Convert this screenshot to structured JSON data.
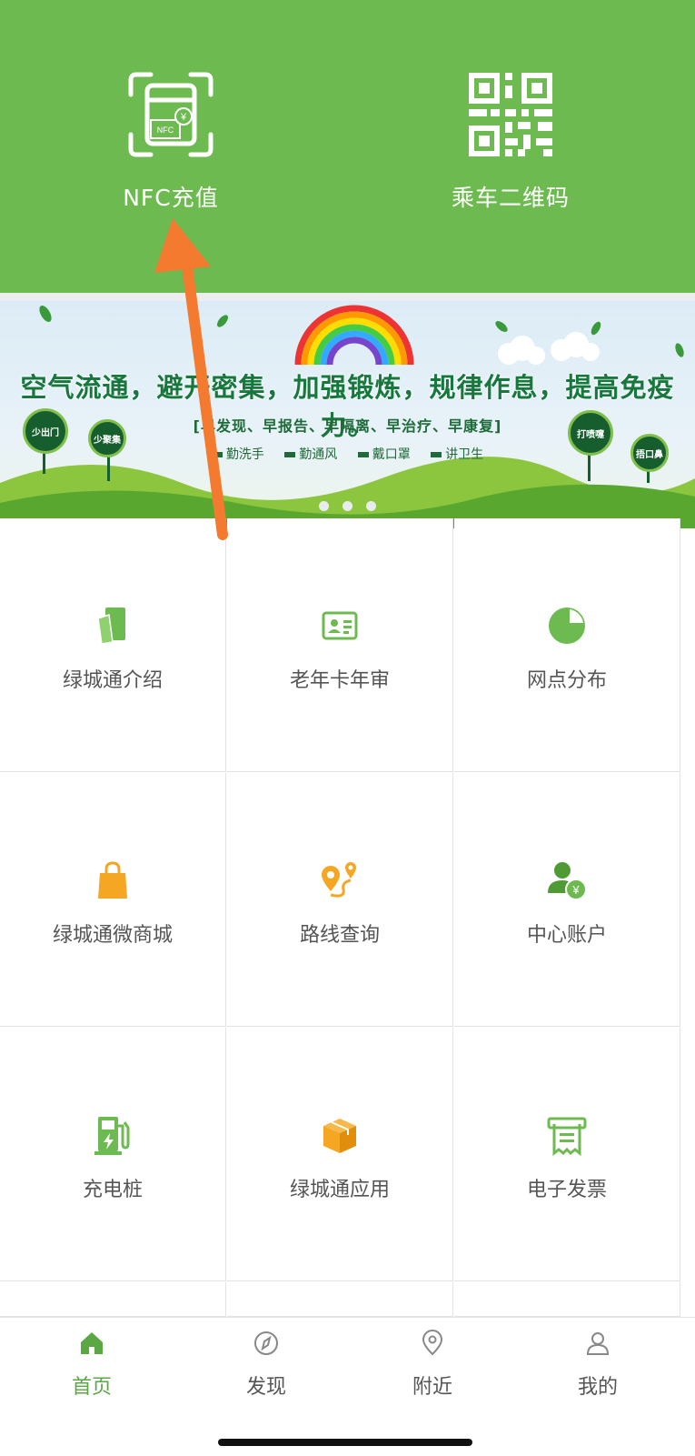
{
  "hero": {
    "nfc": {
      "label": "NFC充值",
      "icon": "nfc-card-icon",
      "icon_text": "NFC"
    },
    "qr": {
      "label": "乘车二维码",
      "icon": "qr-code-icon"
    }
  },
  "banner": {
    "slogan": "空气流通，避开密集，加强锻炼，规律作息，提高免疫力。",
    "subline": "[早发现、早报告、早隔离、早治疗、早康复]",
    "tips": [
      "勤洗手",
      "勤通风",
      "戴口罩",
      "讲卫生"
    ],
    "signs": [
      "少出门",
      "少聚集",
      "打喷嚏",
      "捂口鼻"
    ],
    "page_dots": 3
  },
  "grid": [
    {
      "label": "绿城通介绍",
      "icon": "card-icon",
      "color": "#6dbb50"
    },
    {
      "label": "老年卡年审",
      "icon": "id-card-icon",
      "color": "#6dbb50"
    },
    {
      "label": "网点分布",
      "icon": "pie-chart-icon",
      "color": "#6dbb50"
    },
    {
      "label": "绿城通微商城",
      "icon": "shopping-bag-icon",
      "color": "#f5a623"
    },
    {
      "label": "路线查询",
      "icon": "route-icon",
      "color": "#f5a623"
    },
    {
      "label": "中心账户",
      "icon": "account-yen-icon",
      "color": "#6dbb50"
    },
    {
      "label": "充电桩",
      "icon": "charging-station-icon",
      "color": "#6dbb50"
    },
    {
      "label": "绿城通应用",
      "icon": "box-icon",
      "color": "#f5a623"
    },
    {
      "label": "电子发票",
      "icon": "invoice-icon",
      "color": "#6dbb50"
    }
  ],
  "tabs": [
    {
      "label": "首页",
      "icon": "home-icon",
      "active": true
    },
    {
      "label": "发现",
      "icon": "compass-icon",
      "active": false
    },
    {
      "label": "附近",
      "icon": "location-icon",
      "active": false
    },
    {
      "label": "我的",
      "icon": "user-icon",
      "active": false
    }
  ],
  "colors": {
    "primary": "#6dbb50",
    "accent_orange": "#f5a623",
    "arrow": "#f47a2f"
  }
}
